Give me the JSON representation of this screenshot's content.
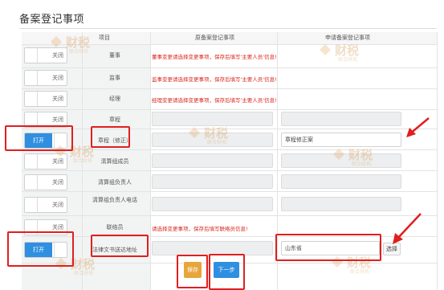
{
  "page": {
    "title": "备案登记事项"
  },
  "table": {
    "headers": [
      "项目",
      "原备案登记事项",
      "申请备案登记事项"
    ],
    "rows": [
      {
        "toggle": "关闭",
        "on": false,
        "label": "董事",
        "note": "董事变更请选择变更事项，保存后填写'主要人员'信息!"
      },
      {
        "toggle": "关闭",
        "on": false,
        "label": "监事",
        "note": "监事变更请选择变更事项，保存后填写'主要人员'信息!"
      },
      {
        "toggle": "关闭",
        "on": false,
        "label": "经理",
        "note": "经理变更请选择变更事项，保存后填写'主要人员'信息!"
      },
      {
        "toggle": "关闭",
        "on": false,
        "label": "章程",
        "note": ""
      },
      {
        "toggle": "打开",
        "on": true,
        "label": "章程（修正）",
        "note": "",
        "new_value": "章程修正案"
      },
      {
        "toggle": "关闭",
        "on": false,
        "label": "清算组成员",
        "note": ""
      },
      {
        "toggle": "关闭",
        "on": false,
        "label": "清算组负责人",
        "note": ""
      },
      {
        "toggle": "关闭",
        "on": false,
        "label": "清算组负责人电话",
        "note": ""
      },
      {
        "toggle": "关闭",
        "on": false,
        "label": "联络员",
        "note": "请选择变更事项，保存后填写联络员信息!"
      },
      {
        "toggle": "打开",
        "on": true,
        "label": "法律文书送达地址",
        "note": "",
        "new_value": "山东省",
        "select_label": "选择"
      }
    ]
  },
  "buttons": {
    "save": "保存",
    "next": "下一步"
  },
  "watermark": {
    "main": "财税",
    "sub": "联合财拓"
  },
  "colors": {
    "accent": "#2f8fe0",
    "warn": "#d9281e",
    "highlight": "#e01f1f",
    "save": "#e7a53c"
  }
}
